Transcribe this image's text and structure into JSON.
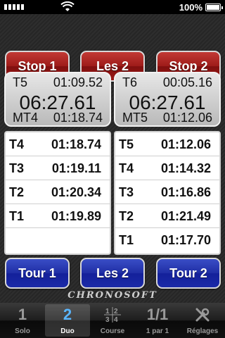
{
  "status": {
    "battery_text": "100%",
    "icons": [
      "signal-icon",
      "wifi-icon",
      "battery-icon"
    ]
  },
  "controls": {
    "left_stop": "Stop 1",
    "center_top": "Les 2",
    "right_stop": "Stop 2",
    "left_tour": "Tour 1",
    "center_bottom": "Les 2",
    "right_tour": "Tour 2"
  },
  "timers": {
    "left": {
      "label": "T5",
      "lap_time": "01:09.52",
      "total": "06:27.61",
      "best_label": "MT4",
      "best_time": "01:18.74"
    },
    "right": {
      "label": "T6",
      "lap_time": "00:05.16",
      "total": "06:27.61",
      "best_label": "MT5",
      "best_time": "01:12.06"
    }
  },
  "laps": {
    "left": [
      {
        "id": "T4",
        "time": "01:18.74"
      },
      {
        "id": "T3",
        "time": "01:19.11"
      },
      {
        "id": "T2",
        "time": "01:20.34"
      },
      {
        "id": "T1",
        "time": "01:19.89"
      }
    ],
    "right": [
      {
        "id": "T5",
        "time": "01:12.06"
      },
      {
        "id": "T4",
        "time": "01:14.32"
      },
      {
        "id": "T3",
        "time": "01:16.86"
      },
      {
        "id": "T2",
        "time": "01:21.49"
      },
      {
        "id": "T1",
        "time": "01:17.70"
      }
    ]
  },
  "brand": "CHRONOSOFT",
  "tabs": [
    {
      "label": "Solo",
      "icon": "1"
    },
    {
      "label": "Duo",
      "icon": "2"
    },
    {
      "label": "Course",
      "icon": "1|2|3|4"
    },
    {
      "label": "1 par 1",
      "icon": "1/1"
    },
    {
      "label": "Réglages",
      "icon": "tools-icon"
    }
  ],
  "colors": {
    "red_button": "#9e1b19",
    "blue_button": "#1f2ea5",
    "active_tab": "#5ab6ff"
  }
}
